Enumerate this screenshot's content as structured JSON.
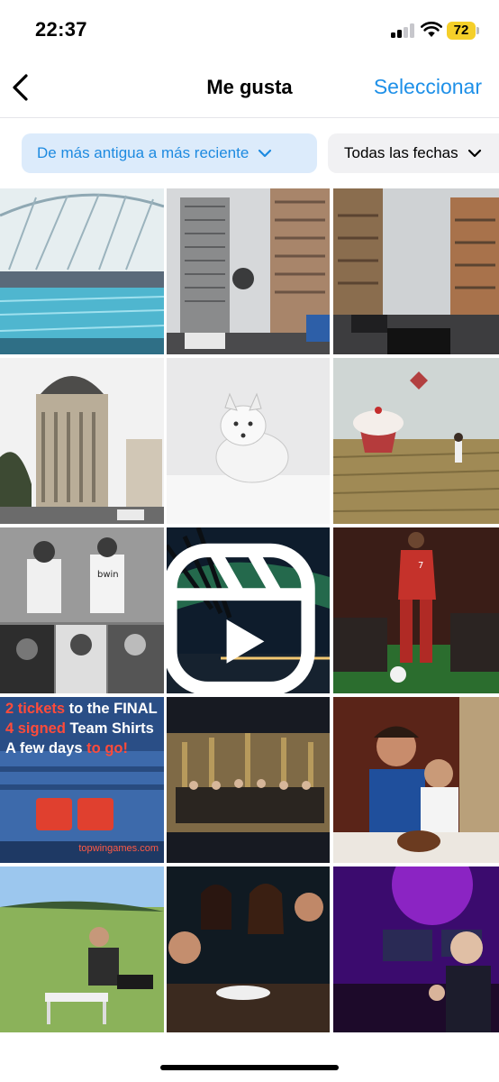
{
  "status_bar": {
    "time": "22:37",
    "battery": "72",
    "battery_color": "#f5cf29"
  },
  "nav": {
    "back_icon": "chevron-left-icon",
    "title": "Me gusta",
    "select_label": "Seleccionar",
    "accent": "#1e90e8"
  },
  "filters": {
    "sort_label": "De más antigua a más reciente",
    "date_label": "Todas las fechas"
  },
  "posts": {
    "promo": {
      "line1_a": "2 tickets",
      "line1_b": " to the ",
      "line1_c": "FINAL",
      "line2_a": "4 signed",
      "line2_b": " Team Shirts",
      "line3_a": "A few days",
      "line3_b": " to go!",
      "footer": "topwingames.com"
    },
    "shirt_text": "bwin",
    "jersey_number": "7"
  }
}
